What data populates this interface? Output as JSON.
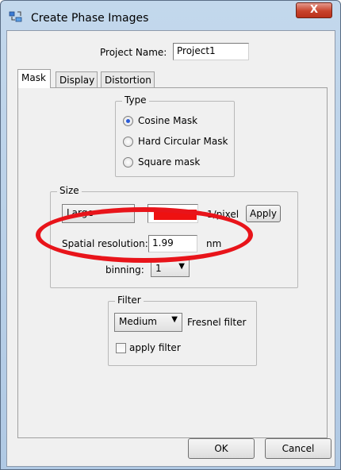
{
  "window": {
    "title": "Create Phase Images",
    "close_label": "X"
  },
  "project": {
    "label": "Project Name:",
    "value": "Project1"
  },
  "tabs": [
    {
      "label": "Mask"
    },
    {
      "label": "Display"
    },
    {
      "label": "Distortion"
    }
  ],
  "type_group": {
    "title": "Type",
    "options": [
      "Cosine Mask",
      "Hard Circular Mask",
      "Square mask"
    ],
    "selected": "Cosine Mask"
  },
  "size_group": {
    "title": "Size",
    "preset_label": "Large",
    "unit_label": "1/pixel",
    "apply_label": "Apply",
    "spatial_label": "Spatial resolution:",
    "spatial_value": "1.99",
    "spatial_unit": "nm",
    "binning_label": "binning:",
    "binning_value": "1"
  },
  "filter_group": {
    "title": "Filter",
    "strength_value": "Medium",
    "filter_type_label": "Fresnel filter",
    "apply_filter_label": "apply filter",
    "apply_filter_checked": false
  },
  "footer": {
    "ok_label": "OK",
    "cancel_label": "Cancel"
  },
  "annotation_color": "#e8141a"
}
